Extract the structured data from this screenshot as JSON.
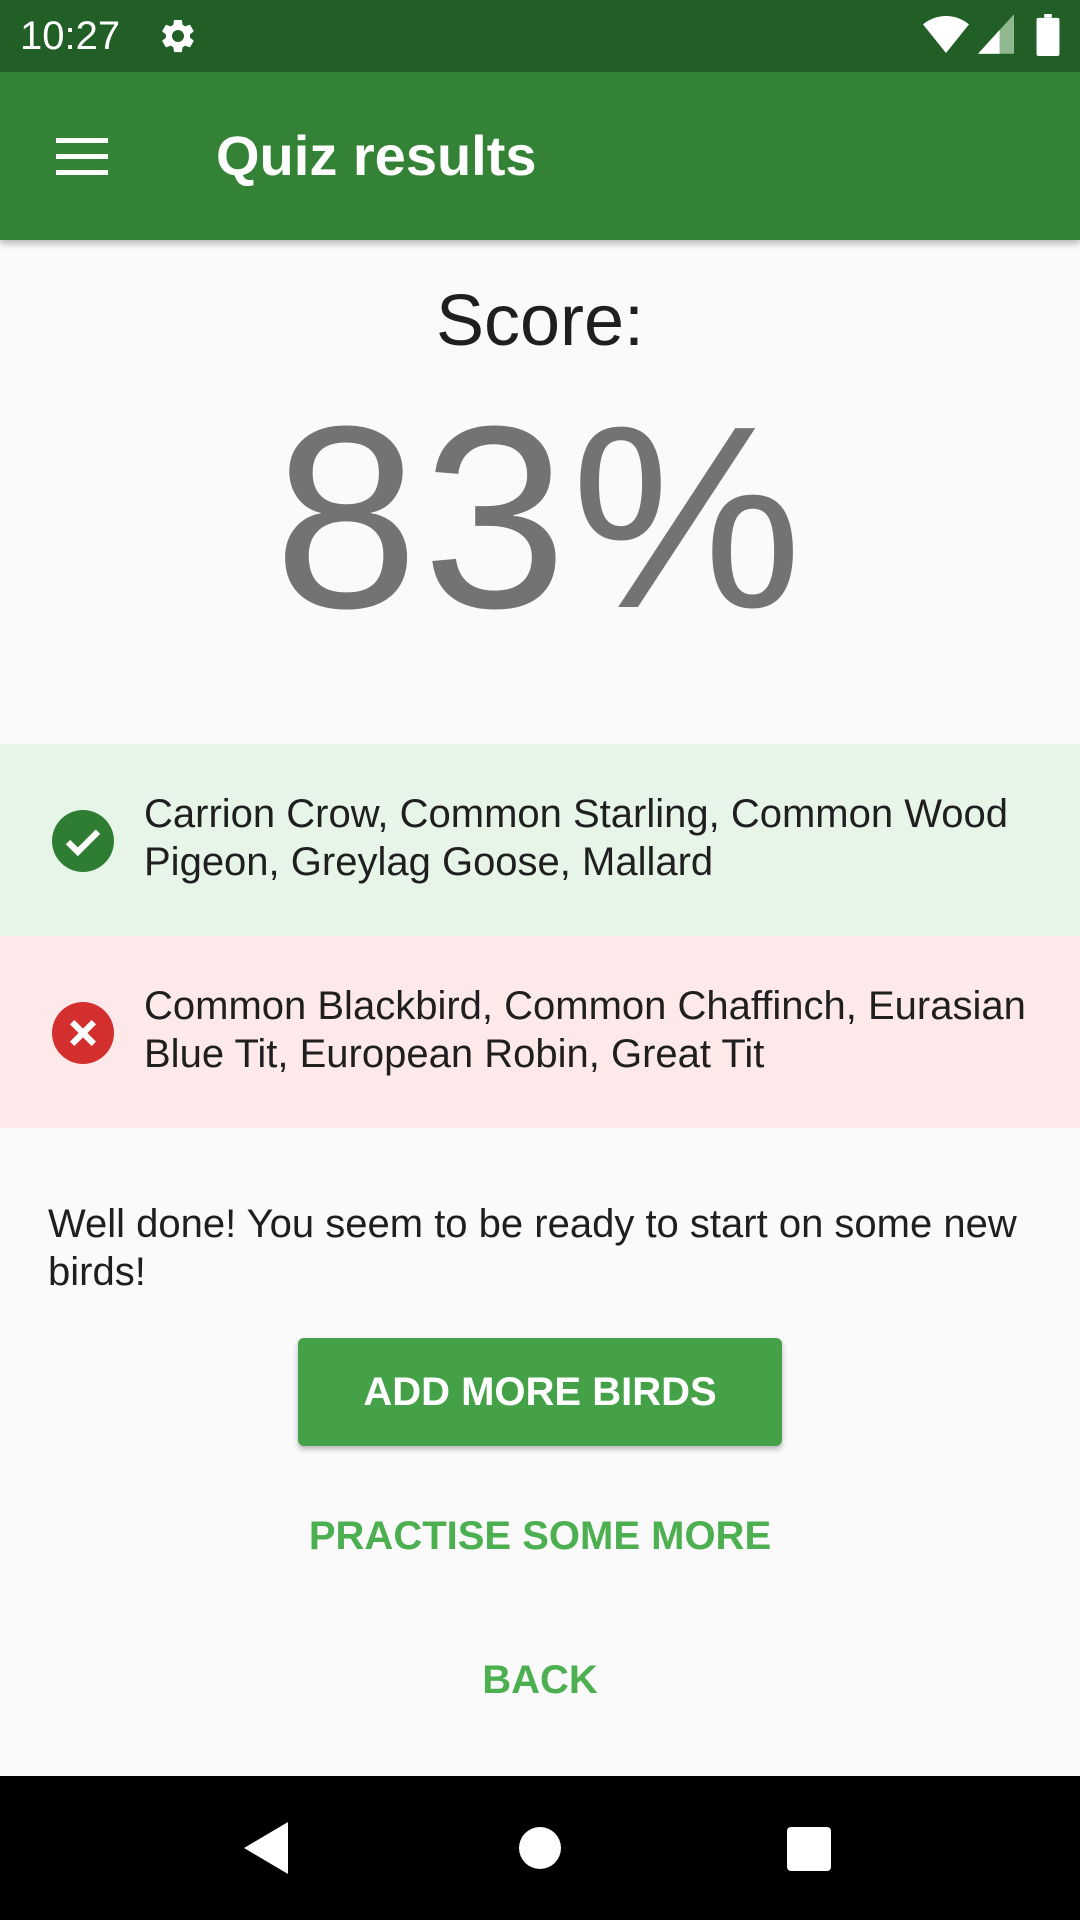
{
  "status_bar": {
    "time": "10:27",
    "icons": [
      "gear-icon",
      "wifi-icon",
      "signal-icon",
      "battery-icon"
    ]
  },
  "app_bar": {
    "title": "Quiz results",
    "menu_icon": "menu-icon"
  },
  "score": {
    "label": "Score:",
    "value": "83%"
  },
  "results": {
    "correct": {
      "icon": "check-circle-icon",
      "text": "Carrion Crow, Common Starling, Common Wood Pigeon, Greylag Goose, Mallard"
    },
    "wrong": {
      "icon": "cross-circle-icon",
      "text": "Common Blackbird, Common Chaffinch, Eurasian Blue Tit, European Robin, Great Tit"
    }
  },
  "message": "Well done! You seem to be ready to start on some new birds!",
  "buttons": {
    "add_more": "ADD MORE BIRDS",
    "practise": "PRACTISE SOME MORE",
    "back": "BACK"
  },
  "nav_bar": {
    "icons": [
      "back-triangle-icon",
      "home-circle-icon",
      "recents-square-icon"
    ]
  },
  "colors": {
    "status_bar": "#225f27",
    "app_bar": "#338235",
    "primary_button": "#45a148",
    "text_button": "#4caf50",
    "correct_bg": "#e7f4e8",
    "correct_icon": "#2e7d32",
    "wrong_bg": "#fde9ea",
    "wrong_icon": "#d32f2f"
  }
}
